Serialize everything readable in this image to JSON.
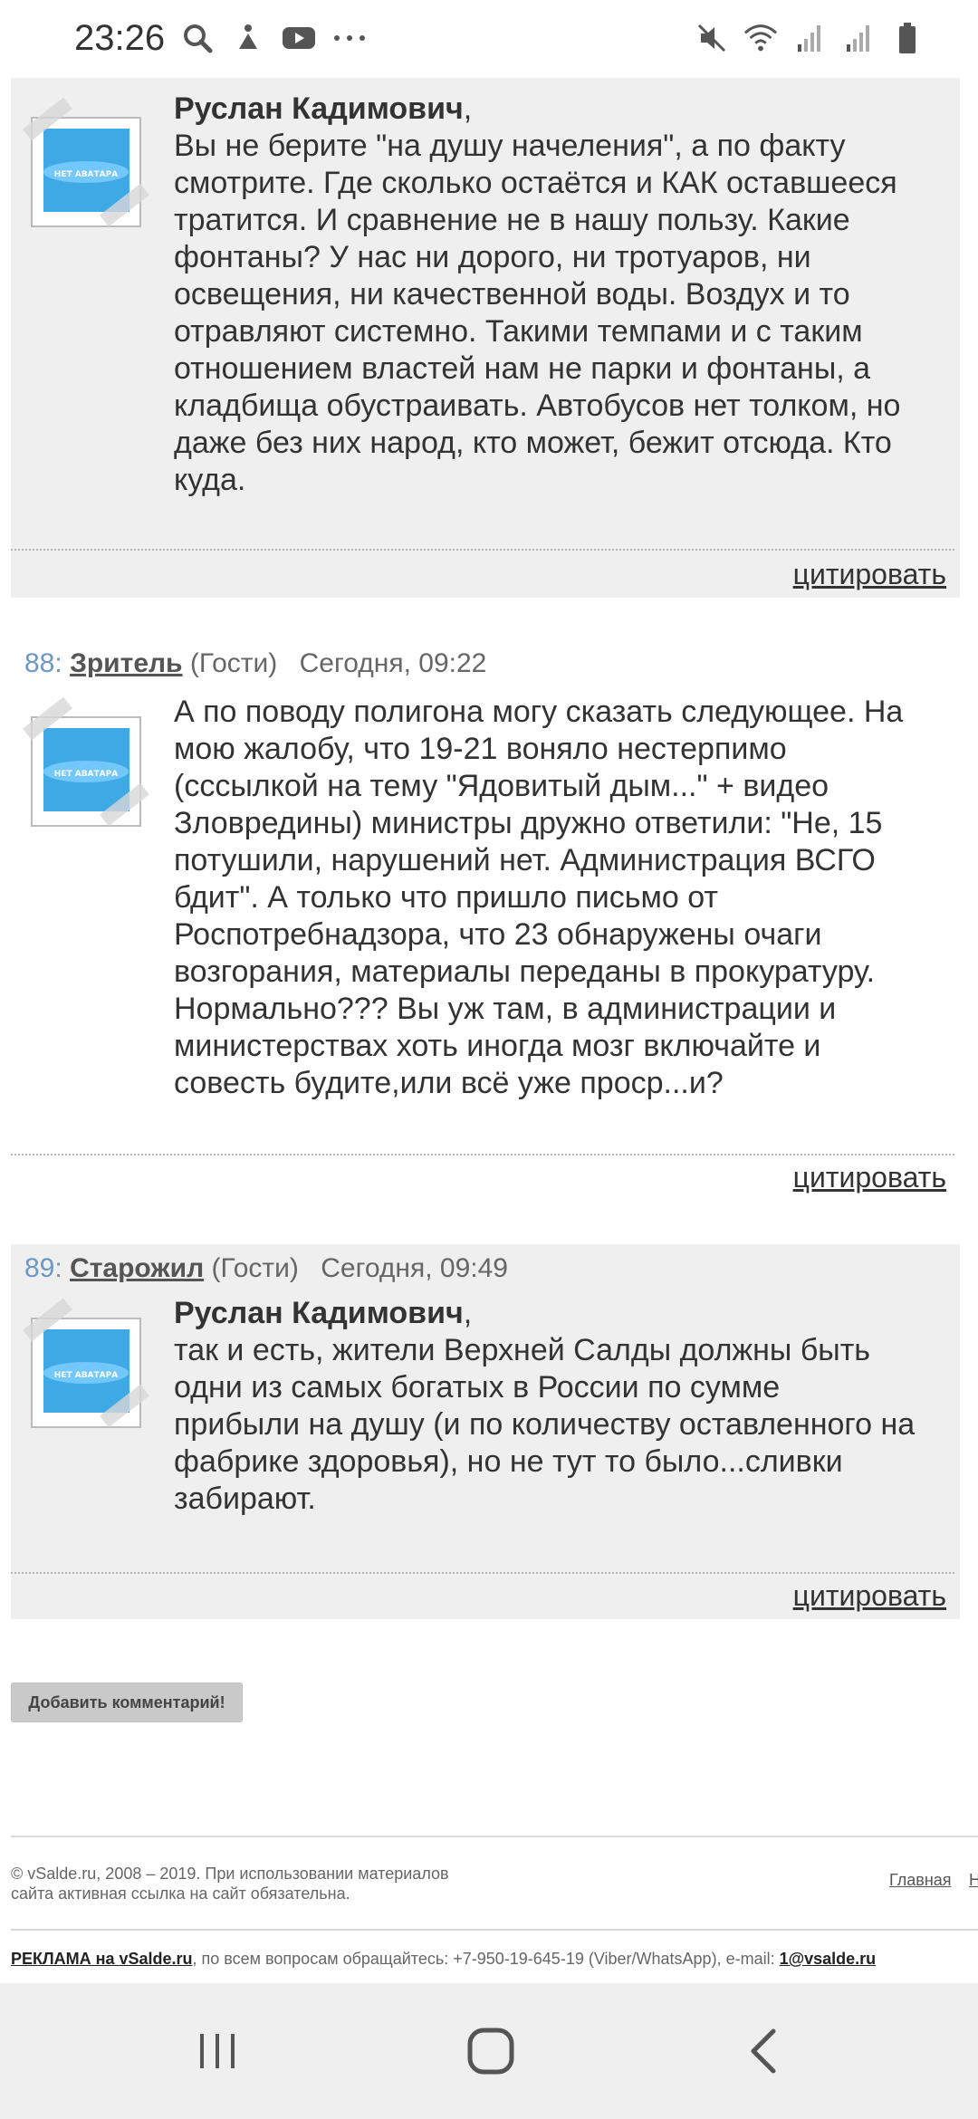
{
  "status_bar": {
    "time": "23:26",
    "left_icons": [
      "search-icon",
      "accessibility-icon",
      "youtube-icon",
      "more-dots-icon"
    ],
    "right_icons": [
      "mute-icon",
      "wifi-icon",
      "signal-icon",
      "signal-icon",
      "battery-icon"
    ]
  },
  "comments": [
    {
      "number": "",
      "author": "",
      "group": "",
      "date": "",
      "addressee": "Руслан Кадимович",
      "addressee_suffix": ",",
      "lines": [
        "Вы не берите \"на душу начеления\", а по факту",
        "смотрите. Где сколько остаётся и КАК оставшееся",
        "тратится. И сравнение не в нашу пользу. Какие",
        "фонтаны? У нас ни дорого, ни тротуаров, ни",
        "освещения, ни качественной воды. Воздух и то",
        "отравляют системно. Такими темпами и с таким",
        "отношением властей нам не парки и фонтаны, а",
        "кладбища обустраивать. Автобусов нет толком, но",
        "даже без них народ, кто может, бежит отсюда. Кто",
        "куда."
      ],
      "avatar_label": "НЕТ АВАТАРА",
      "quote_label": "цитировать"
    },
    {
      "number": "88:",
      "author": "Зритель",
      "group": "(Гости)",
      "date": "Сегодня, 09:22",
      "addressee": "",
      "addressee_suffix": "",
      "lines": [
        "А по поводу полигона могу сказать следующее. На",
        "мою жалобу, что 19-21 воняло нестерпимо",
        "(сссылкой на тему \"Ядовитый дым...\" + видео",
        "Зловредины) министры дружно ответили: \"Не, 15",
        "потушили, нарушений нет. Администрация ВСГО",
        "бдит\". А только что пришло письмо от",
        "Роспотребнадзора, что 23 обнаружены очаги",
        "возгорания, материалы переданы в прокуратуру.",
        "Нормально??? Вы уж там, в администрации и",
        "министерствах хоть иногда мозг включайте и",
        "совесть будите,или всё уже проср...и?"
      ],
      "avatar_label": "НЕТ АВАТАРА",
      "quote_label": "цитировать"
    },
    {
      "number": "89:",
      "author": "Старожил",
      "group": "(Гости)",
      "date": "Сегодня, 09:49",
      "addressee": "Руслан Кадимович",
      "addressee_suffix": ",",
      "lines": [
        "так и есть, жители Верхней Салды должны быть",
        "одни из самых богатых в России по сумме",
        "прибыли на душу (и по количеству оставленного на",
        "фабрике здоровья), но не тут то было...сливки",
        "забирают."
      ],
      "avatar_label": "НЕТ АВАТАРА",
      "quote_label": "цитировать"
    }
  ],
  "add_comment_label": "Добавить комментарий!",
  "footer": {
    "copyright_line1": "© vSalde.ru, 2008 – 2019. При использовании материалов",
    "copyright_line2": "сайта активная ссылка на сайт обязательна.",
    "link_main": "Главная",
    "link_next": "Н",
    "ads_link": "РЕКЛАМА на vSalde.ru",
    "ads_text": ", по всем вопросам обращайтесь: +7-950-19-645-19 (Viber/WhatsApp), e-mail: ",
    "ads_email": "1@vsalde.ru"
  },
  "nav_bar": {
    "buttons": [
      "recent-apps-icon",
      "home-icon",
      "back-icon"
    ]
  },
  "colors": {
    "comment_bg": "#efefef",
    "comment_number": "#6b98c4",
    "text": "#333333"
  }
}
